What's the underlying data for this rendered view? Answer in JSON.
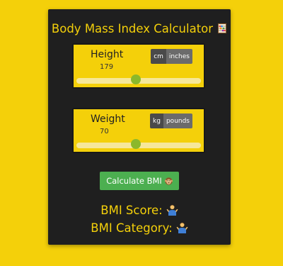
{
  "header": {
    "title": "Body Mass Index Calculator",
    "icon": "abacus-icon"
  },
  "height_panel": {
    "label": "Height",
    "value": "179",
    "units": [
      "cm",
      "inches"
    ],
    "active_unit": "cm",
    "slider_fraction": 0.48
  },
  "weight_panel": {
    "label": "Weight",
    "value": "70",
    "units": [
      "kg",
      "pounds"
    ],
    "active_unit": "kg",
    "slider_fraction": 0.48
  },
  "calculate_button": {
    "label": "Calculate BMI",
    "icon": "monkey-face-icon"
  },
  "results": {
    "score_label": "BMI Score:",
    "category_label": "BMI Category:",
    "score_icon": "person-shrugging-icon",
    "category_icon": "person-shrugging-icon"
  },
  "colors": {
    "background": "#f4d00a",
    "card": "#1f1f1f",
    "accent": "#f4d00a",
    "button": "#4caf50",
    "slider_thumb": "#8bb82b"
  }
}
